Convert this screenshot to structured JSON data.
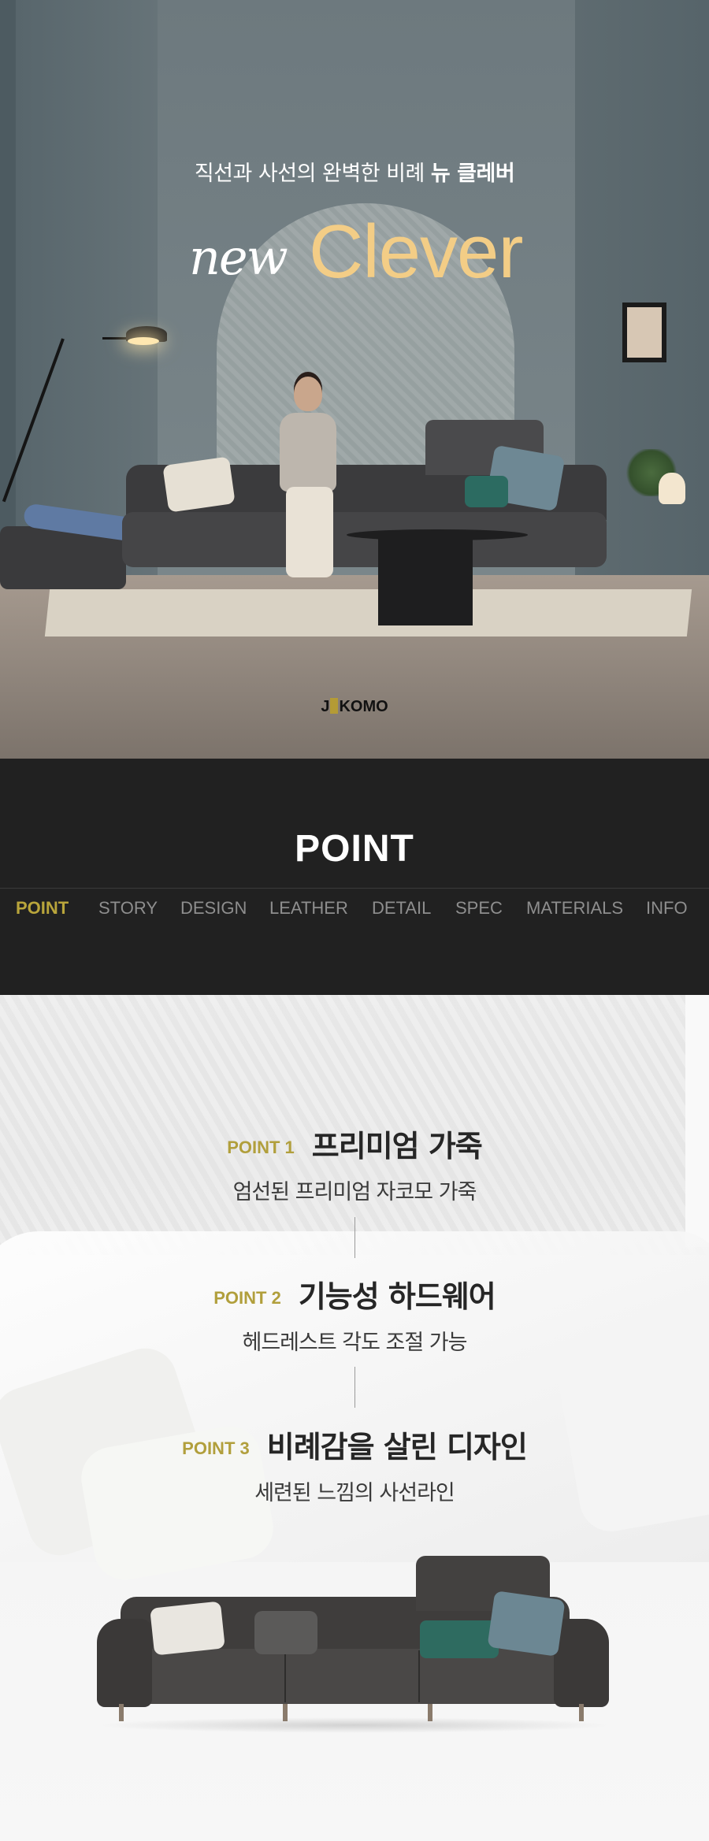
{
  "hero": {
    "tagline_prefix": "직선과 사선의 완벽한 비례",
    "tagline_strong": "뉴 클레버",
    "logo_script": "new",
    "logo_main": "Clever",
    "brand_left": "J",
    "brand_right": "KOMO"
  },
  "section": {
    "heading": "POINT"
  },
  "nav": {
    "items": [
      {
        "label": "POINT",
        "active": true
      },
      {
        "label": "STORY",
        "active": false
      },
      {
        "label": "DESIGN",
        "active": false
      },
      {
        "label": "LEATHER",
        "active": false
      },
      {
        "label": "DETAIL",
        "active": false
      },
      {
        "label": "SPEC",
        "active": false
      },
      {
        "label": "MATERIALS",
        "active": false
      },
      {
        "label": "INFO",
        "active": false
      }
    ]
  },
  "points": [
    {
      "label": "POINT 1",
      "title": "프리미엄 가죽",
      "desc": "엄선된 프리미엄 자코모 가죽"
    },
    {
      "label": "POINT 2",
      "title": "기능성 하드웨어",
      "desc": "헤드레스트 각도 조절 가능"
    },
    {
      "label": "POINT 3",
      "title": "비례감을 살린 디자인",
      "desc": "세련된 느낌의 사선라인"
    }
  ],
  "colors": {
    "accent": "#b9a53b",
    "logo_gold": "#f3cd86",
    "dark_band": "#212121",
    "nav_inactive": "#8e8e8e"
  }
}
